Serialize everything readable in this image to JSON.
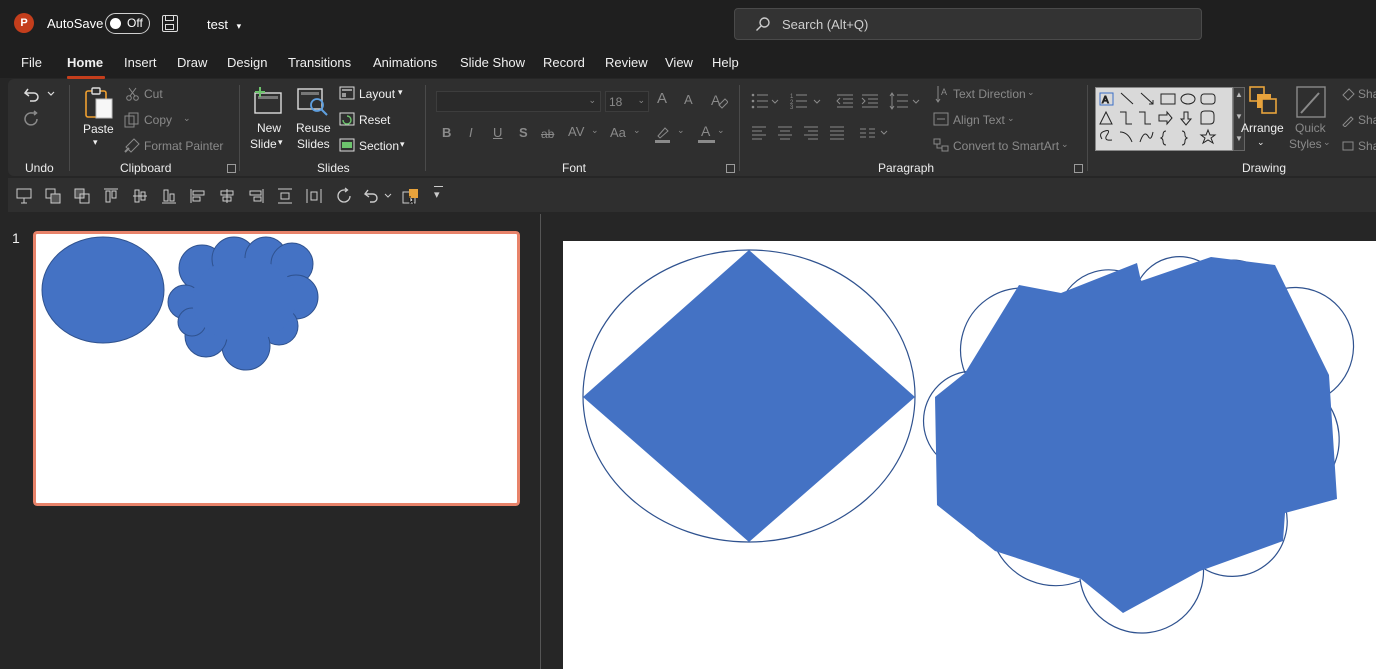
{
  "titlebar": {
    "app_letter": "P",
    "autosave_label": "AutoSave",
    "autosave_state": "Off",
    "document_title": "test",
    "search_placeholder": "Search (Alt+Q)"
  },
  "menu": [
    "File",
    "Home",
    "Insert",
    "Draw",
    "Design",
    "Transitions",
    "Animations",
    "Slide Show",
    "Record",
    "Review",
    "View",
    "Help"
  ],
  "menu_active": "Home",
  "ribbon": {
    "undo": {
      "label": "Undo"
    },
    "clipboard": {
      "label": "Clipboard",
      "paste": "Paste",
      "cut": "Cut",
      "copy": "Copy",
      "format_painter": "Format Painter"
    },
    "slides": {
      "label": "Slides",
      "new_slide_1": "New",
      "new_slide_2": "Slide",
      "reuse_1": "Reuse",
      "reuse_2": "Slides",
      "layout": "Layout",
      "reset": "Reset",
      "section": "Section"
    },
    "font": {
      "label": "Font",
      "font_name": "",
      "font_size": "18",
      "bold": "B",
      "italic": "I",
      "underline": "U",
      "shadow": "S",
      "strike": "ab",
      "spacing": "AV",
      "case": "Aa",
      "grow": "A",
      "shrink": "A",
      "font_color": "A"
    },
    "paragraph": {
      "label": "Paragraph",
      "text_direction": "Text Direction",
      "align_text": "Align Text",
      "convert_smartart": "Convert to SmartArt"
    },
    "drawing": {
      "label": "Drawing",
      "arrange": "Arrange",
      "quick_1": "Quick",
      "quick_2": "Styles",
      "shape_fill": "Sha",
      "shape_outline": "Sha",
      "shape_effects": "Sha"
    }
  },
  "slides_panel": {
    "slide_numbers": [
      "1"
    ]
  },
  "colors": {
    "accent": "#c43e1c",
    "shape_fill": "#4472c4",
    "shape_outline": "#2f528f",
    "thumb_border": "#e8836a"
  }
}
